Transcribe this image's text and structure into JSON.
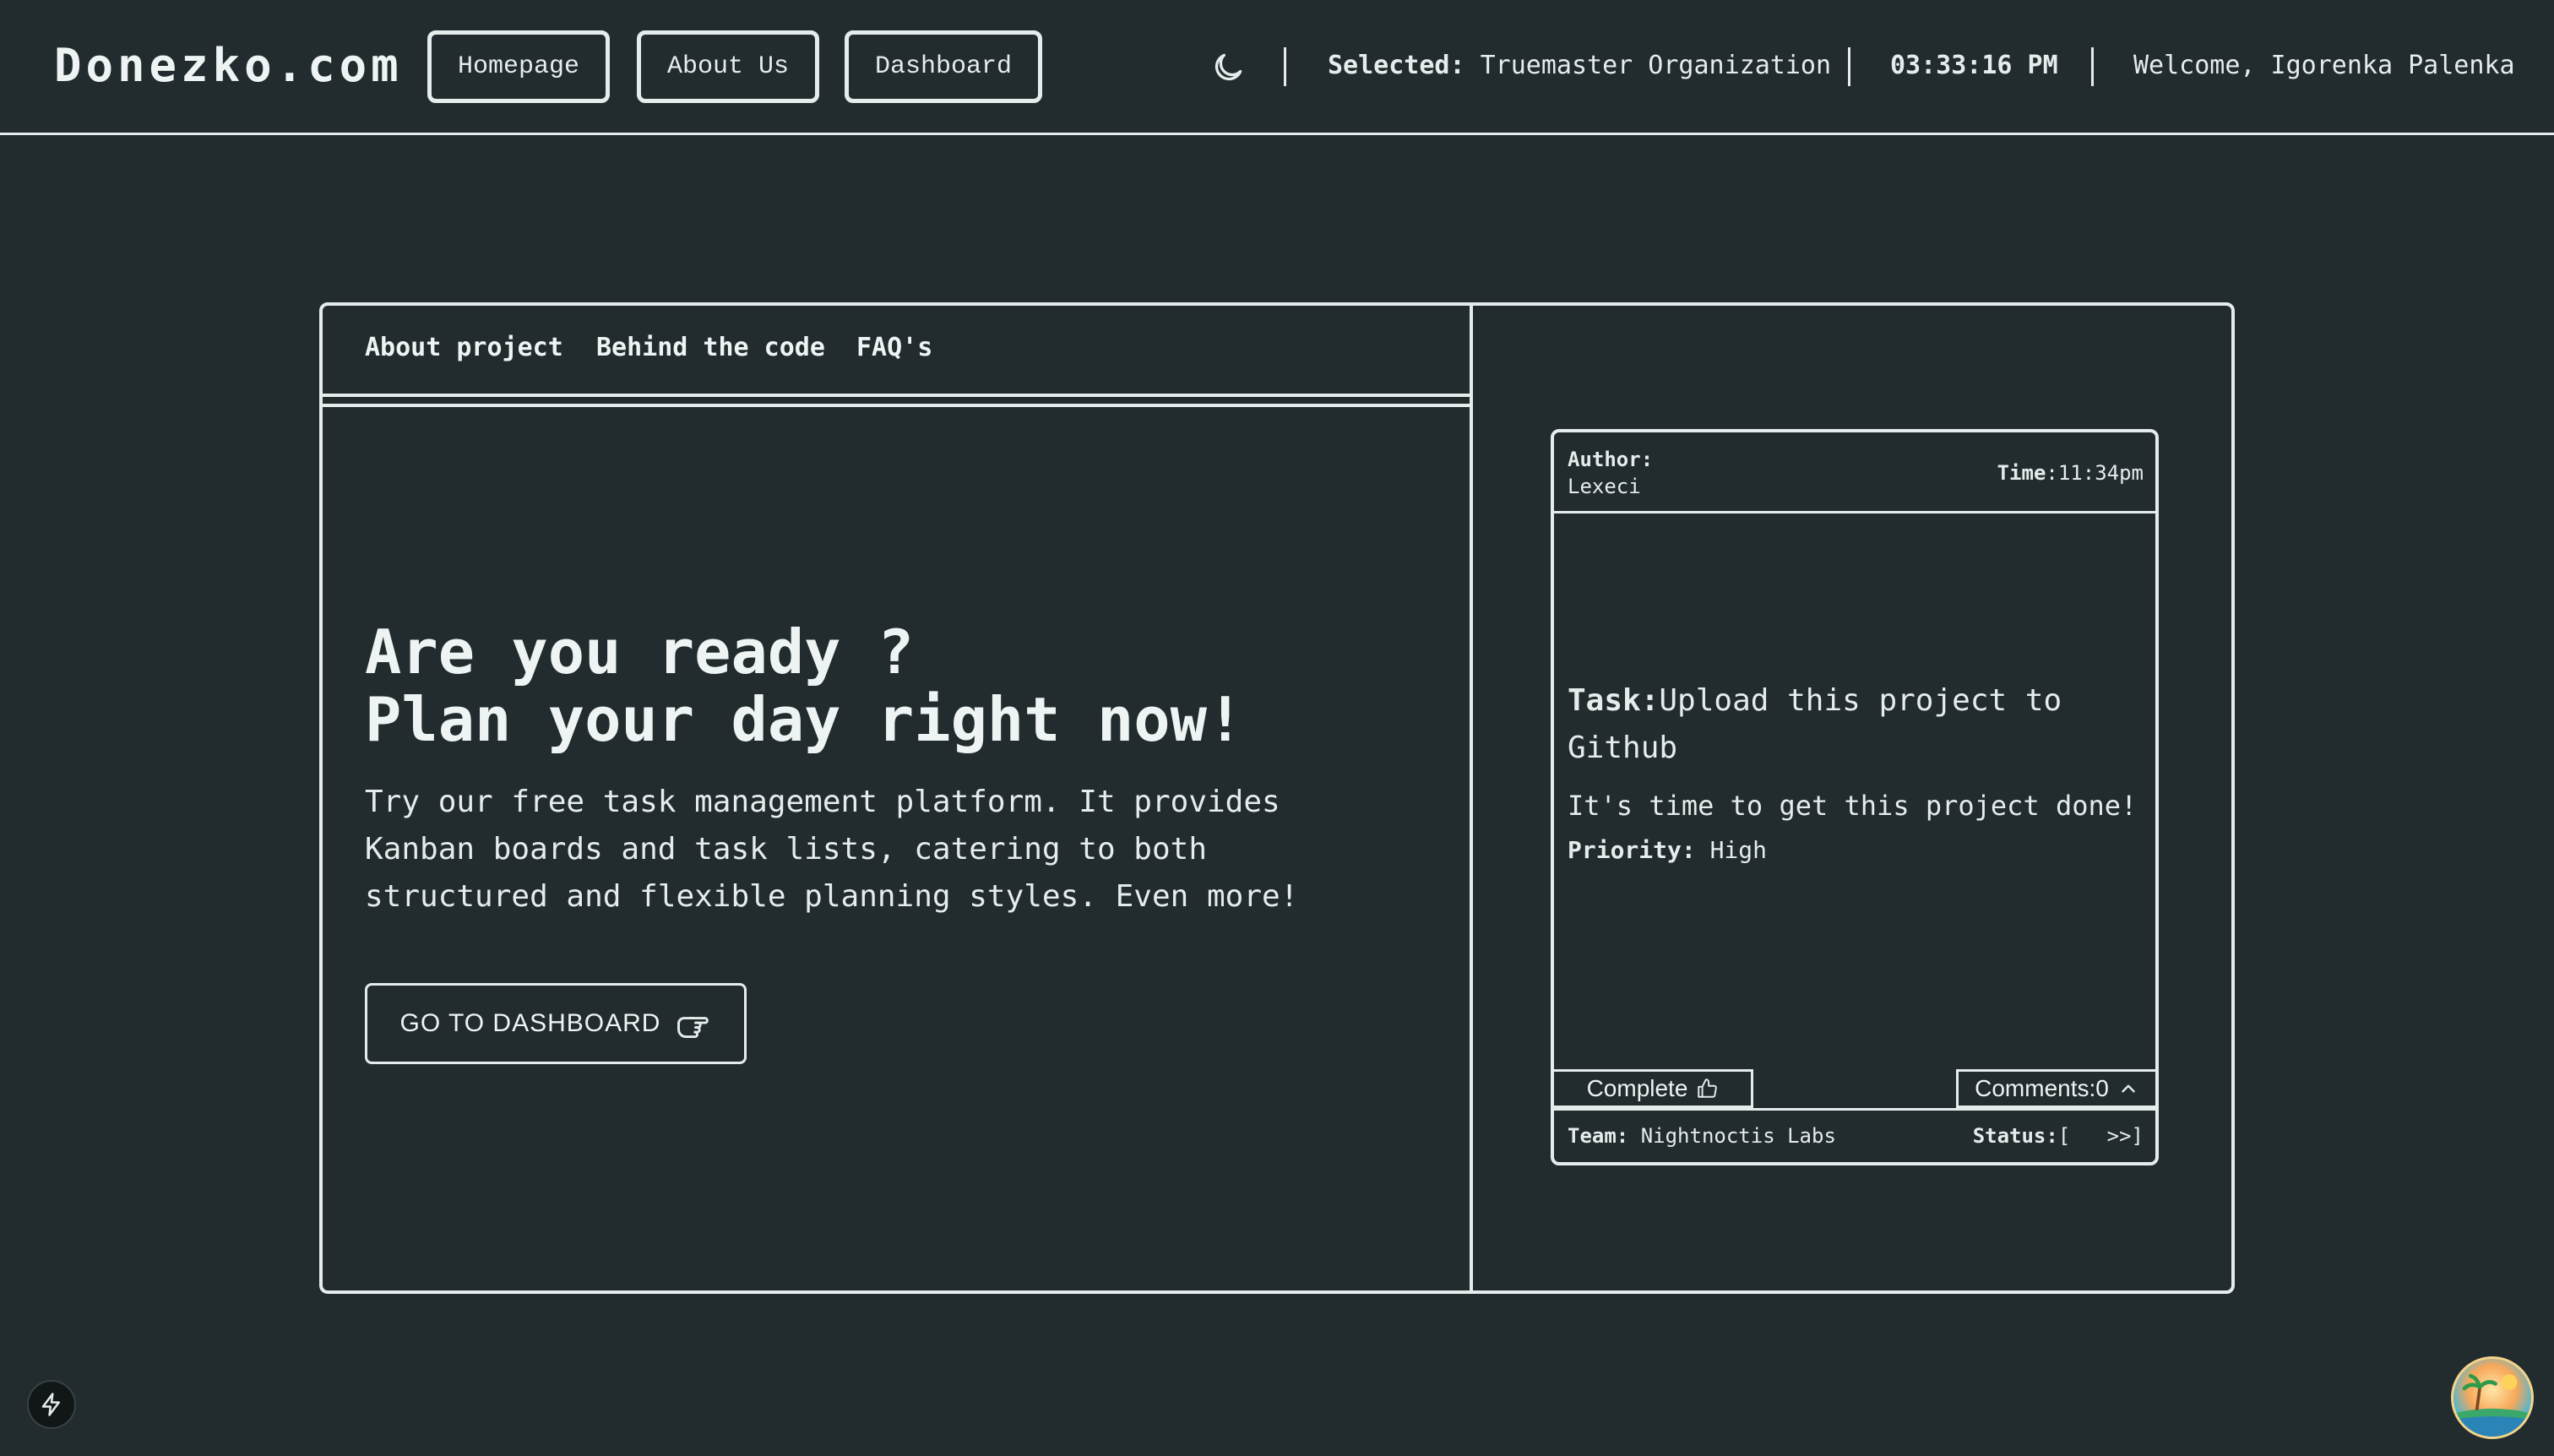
{
  "header": {
    "brand": "Donezko.com",
    "nav": [
      "Homepage",
      "About Us",
      "Dashboard"
    ],
    "selected_label": "Selected:",
    "selected_value": "Truemaster Organization",
    "clock": "03:33:16 PM",
    "welcome": "Welcome, Igorenka Palenka",
    "theme_icon": "moon-icon"
  },
  "tabs": [
    "About project",
    "Behind the code",
    "FAQ's"
  ],
  "hero": {
    "title_line1": "Are you ready ?",
    "title_line2": "Plan your day right now!",
    "description": "Try our free task management platform. It provides Kanban boards and task lists, catering to both structured and flexible planning styles. Even more!",
    "cta_label": "GO TO DASHBOARD",
    "cta_icon": "pointing-hand-icon"
  },
  "task_card": {
    "author_label": "Author:",
    "author_name": "Lexeci",
    "time_label": "Time",
    "time_value": ":11:34pm",
    "task_label": "Task:",
    "task_title": "Upload this project to Github",
    "description": "It's time to get this project done!",
    "priority_label": "Priority:",
    "priority_value": "High",
    "complete_label": "Complete",
    "comments_label": "Comments:0",
    "team_label": "Team:",
    "team_value": "Nightnoctis Labs",
    "status_label": "Status:",
    "status_value": "[   >>]"
  },
  "colors": {
    "background": "#222b2d",
    "foreground": "#e4ecec"
  }
}
